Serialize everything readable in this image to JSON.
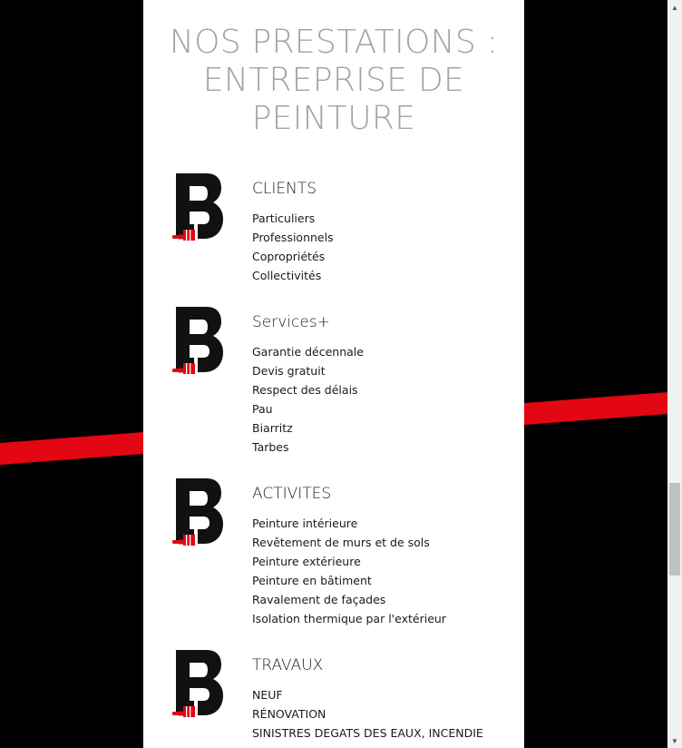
{
  "page": {
    "title": "NOS PRESTATIONS : ENTREPRISE DE PEINTURE"
  },
  "colors": {
    "background": "#000000",
    "panel": "#ffffff",
    "accent_red": "#e30613",
    "title_gray": "#a3a3a3"
  },
  "sections": [
    {
      "heading": "CLIENTS",
      "icon": "brand-b-paintbrush-icon",
      "items": [
        "Particuliers",
        "Professionnels",
        "Copropriétés",
        "Collectivités"
      ]
    },
    {
      "heading": "Services+",
      "icon": "brand-b-paintbrush-icon",
      "items": [
        "Garantie décennale",
        "Devis gratuit",
        "Respect des délais",
        "Pau",
        "Biarritz",
        "Tarbes"
      ]
    },
    {
      "heading": "ACTIVITES",
      "icon": "brand-b-paintbrush-icon",
      "items": [
        "Peinture intérieure",
        "Revêtement de murs et de sols",
        "Peinture extérieure",
        "Peinture en bâtiment",
        "Ravalement de façades",
        "Isolation thermique par l'extérieur"
      ]
    },
    {
      "heading": "TRAVAUX",
      "icon": "brand-b-paintbrush-icon",
      "items": [
        "NEUF",
        "RÉNOVATION",
        "SINISTRES DEGATS DES EAUX, INCENDIE"
      ]
    }
  ],
  "scrollbar": {
    "up_icon": "scroll-up-arrow-icon",
    "down_icon": "scroll-down-arrow-icon"
  }
}
